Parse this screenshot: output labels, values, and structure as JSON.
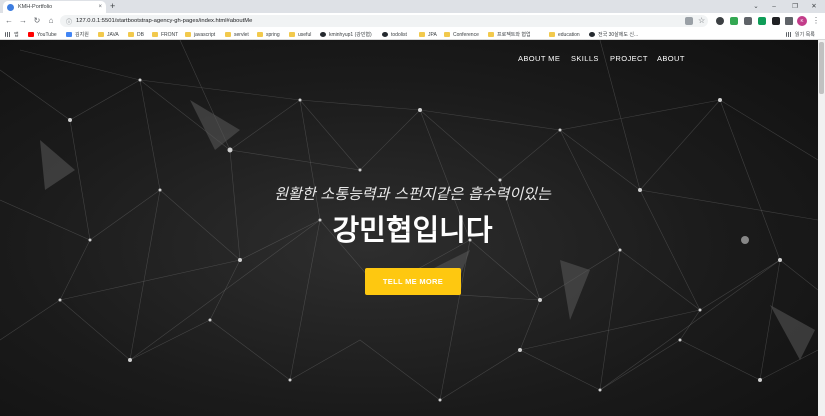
{
  "browser": {
    "tab_title": "KMH-Portfolio",
    "tab_close": "×",
    "new_tab": "+",
    "window_controls": {
      "expand": "⌄",
      "minimize": "–",
      "maximize": "❐",
      "close": "✕"
    },
    "nav": {
      "back": "←",
      "forward": "→",
      "reload": "↻",
      "home": "⌂"
    },
    "url": "127.0.0.1:5501/startbootstrap-agency-gh-pages/index.html#aboutMe",
    "profile_initial": "K",
    "bookmarks": [
      {
        "label": "앱",
        "icon": "apps-grid-icon"
      },
      {
        "label": "YouTube",
        "icon": "youtube-icon"
      },
      {
        "label": "김지원",
        "icon": "bookmark-icon"
      },
      {
        "label": "JAVA",
        "icon": "folder-icon"
      },
      {
        "label": "DB",
        "icon": "folder-icon"
      },
      {
        "label": "FRONT",
        "icon": "folder-icon"
      },
      {
        "label": "javascript",
        "icon": "folder-icon"
      },
      {
        "label": "servlet",
        "icon": "folder-icon"
      },
      {
        "label": "spring",
        "icon": "folder-icon"
      },
      {
        "label": "useful",
        "icon": "folder-icon"
      },
      {
        "label": "kminhyup1 (강민협)",
        "icon": "github-icon"
      },
      {
        "label": "todolist",
        "icon": "globe-icon"
      },
      {
        "label": "JPA",
        "icon": "folder-icon"
      },
      {
        "label": "Conference",
        "icon": "folder-icon"
      },
      {
        "label": "프로젝트와 협업",
        "icon": "folder-icon"
      },
      {
        "label": "education",
        "icon": "folder-icon"
      },
      {
        "label": "전국 30살에도 신...",
        "icon": "globe-icon"
      }
    ],
    "reading_list": "읽기 목록"
  },
  "page": {
    "nav_items": [
      "ABOUT ME",
      "SKILLS",
      "PROJECT",
      "ABOUT"
    ],
    "subtitle": "원활한 소통능력과 스펀지같은 흡수력이있는",
    "headline": "강민협입니다",
    "cta_label": "TELL ME MORE"
  },
  "colors": {
    "accent": "#fec810",
    "hero_bg": "#1c1c1c",
    "nav_text": "#ffffff"
  }
}
